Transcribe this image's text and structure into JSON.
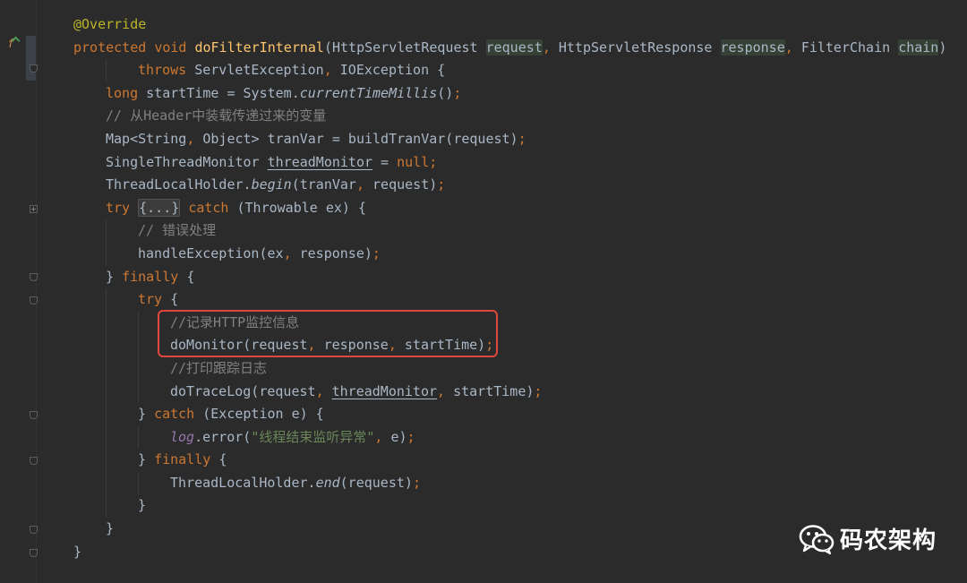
{
  "colors": {
    "background": "#2b2b2b",
    "keyword": "#cc7832",
    "method": "#ffc66d",
    "annotation": "#bbb529",
    "comment": "#808080",
    "string": "#6a8759",
    "field": "#9876aa",
    "text": "#a9b7c6",
    "highlight_box": "#e0483f"
  },
  "gutter": {
    "override_icon": "fx-override-icon"
  },
  "lines": [
    {
      "indent": 0,
      "tokens": [
        {
          "t": "@Override",
          "c": "ann"
        }
      ]
    },
    {
      "indent": 0,
      "tokens": [
        {
          "t": "protected ",
          "c": "k"
        },
        {
          "t": "void ",
          "c": "k"
        },
        {
          "t": "doFilterInternal",
          "c": "fn"
        },
        {
          "t": "(HttpServletRequest "
        },
        {
          "t": "request",
          "c": "hl"
        },
        {
          "t": ", ",
          "c": "k"
        },
        {
          "t": "HttpServletResponse "
        },
        {
          "t": "response",
          "c": "hl"
        },
        {
          "t": ", ",
          "c": "k"
        },
        {
          "t": "FilterChain "
        },
        {
          "t": "chain",
          "c": "hl"
        },
        {
          "t": ")"
        }
      ]
    },
    {
      "indent": 2,
      "tokens": [
        {
          "t": "throws ",
          "c": "k"
        },
        {
          "t": "ServletException"
        },
        {
          "t": ", ",
          "c": "k"
        },
        {
          "t": "IOException {"
        }
      ]
    },
    {
      "indent": 1,
      "tokens": [
        {
          "t": "long ",
          "c": "k"
        },
        {
          "t": "startTime = System."
        },
        {
          "t": "currentTimeMillis",
          "c": "it"
        },
        {
          "t": "()"
        },
        {
          "t": ";",
          "c": "k"
        }
      ]
    },
    {
      "indent": 1,
      "tokens": [
        {
          "t": "// 从Header中装载传递过来的变量",
          "c": "cm"
        }
      ]
    },
    {
      "indent": 1,
      "tokens": [
        {
          "t": "Map<String"
        },
        {
          "t": ", ",
          "c": "k"
        },
        {
          "t": "Object> tranVar = buildTranVar(request)"
        },
        {
          "t": ";",
          "c": "k"
        }
      ]
    },
    {
      "indent": 1,
      "tokens": [
        {
          "t": "SingleThreadMonitor "
        },
        {
          "t": "threadMonitor",
          "c": "ul"
        },
        {
          "t": " = "
        },
        {
          "t": "null",
          "c": "k"
        },
        {
          "t": ";",
          "c": "k"
        }
      ]
    },
    {
      "indent": 1,
      "tokens": [
        {
          "t": "ThreadLocalHolder."
        },
        {
          "t": "begin",
          "c": "it"
        },
        {
          "t": "(tranVar"
        },
        {
          "t": ", ",
          "c": "k"
        },
        {
          "t": "request)"
        },
        {
          "t": ";",
          "c": "k"
        }
      ]
    },
    {
      "indent": 1,
      "tokens": [
        {
          "t": "try ",
          "c": "k"
        },
        {
          "t": "{...}",
          "c": "fb"
        },
        {
          "t": " "
        },
        {
          "t": "catch ",
          "c": "k"
        },
        {
          "t": "(Throwable ex) {"
        }
      ]
    },
    {
      "indent": 2,
      "tokens": [
        {
          "t": "// 错误处理",
          "c": "cm"
        }
      ]
    },
    {
      "indent": 2,
      "tokens": [
        {
          "t": "handleException(ex"
        },
        {
          "t": ", ",
          "c": "k"
        },
        {
          "t": "response)"
        },
        {
          "t": ";",
          "c": "k"
        }
      ]
    },
    {
      "indent": 1,
      "tokens": [
        {
          "t": "} "
        },
        {
          "t": "finally ",
          "c": "k"
        },
        {
          "t": "{"
        }
      ]
    },
    {
      "indent": 2,
      "tokens": [
        {
          "t": "try ",
          "c": "k"
        },
        {
          "t": "{"
        }
      ]
    },
    {
      "indent": 3,
      "tokens": [
        {
          "t": "//记录HTTP监控信息",
          "c": "cm"
        }
      ]
    },
    {
      "indent": 3,
      "tokens": [
        {
          "t": "doMonitor(request"
        },
        {
          "t": ", ",
          "c": "k"
        },
        {
          "t": "response"
        },
        {
          "t": ", ",
          "c": "k"
        },
        {
          "t": "startTime)"
        },
        {
          "t": ";",
          "c": "k"
        }
      ]
    },
    {
      "indent": 3,
      "tokens": [
        {
          "t": "//打印跟踪日志",
          "c": "cm"
        }
      ]
    },
    {
      "indent": 3,
      "tokens": [
        {
          "t": "doTraceLog(request"
        },
        {
          "t": ", ",
          "c": "k"
        },
        {
          "t": "threadMonitor",
          "c": "ul"
        },
        {
          "t": ", ",
          "c": "k"
        },
        {
          "t": "startTime)"
        },
        {
          "t": ";",
          "c": "k"
        }
      ]
    },
    {
      "indent": 2,
      "tokens": [
        {
          "t": "} "
        },
        {
          "t": "catch ",
          "c": "k"
        },
        {
          "t": "(Exception e) {"
        }
      ]
    },
    {
      "indent": 3,
      "tokens": [
        {
          "t": "log",
          "c": "fld it"
        },
        {
          "t": ".error("
        },
        {
          "t": "\"线程结束监听异常\"",
          "c": "str"
        },
        {
          "t": ", ",
          "c": "k"
        },
        {
          "t": "e)"
        },
        {
          "t": ";",
          "c": "k"
        }
      ]
    },
    {
      "indent": 2,
      "tokens": [
        {
          "t": "} "
        },
        {
          "t": "finally ",
          "c": "k"
        },
        {
          "t": "{"
        }
      ]
    },
    {
      "indent": 3,
      "tokens": [
        {
          "t": "ThreadLocalHolder."
        },
        {
          "t": "end",
          "c": "it"
        },
        {
          "t": "(request)"
        },
        {
          "t": ";",
          "c": "k"
        }
      ]
    },
    {
      "indent": 2,
      "tokens": [
        {
          "t": "}"
        }
      ]
    },
    {
      "indent": 1,
      "tokens": [
        {
          "t": "}"
        }
      ]
    },
    {
      "indent": 0,
      "tokens": [
        {
          "t": "}"
        }
      ]
    }
  ],
  "watermark": {
    "icon": "wechat-icon",
    "text": "码农架构"
  }
}
